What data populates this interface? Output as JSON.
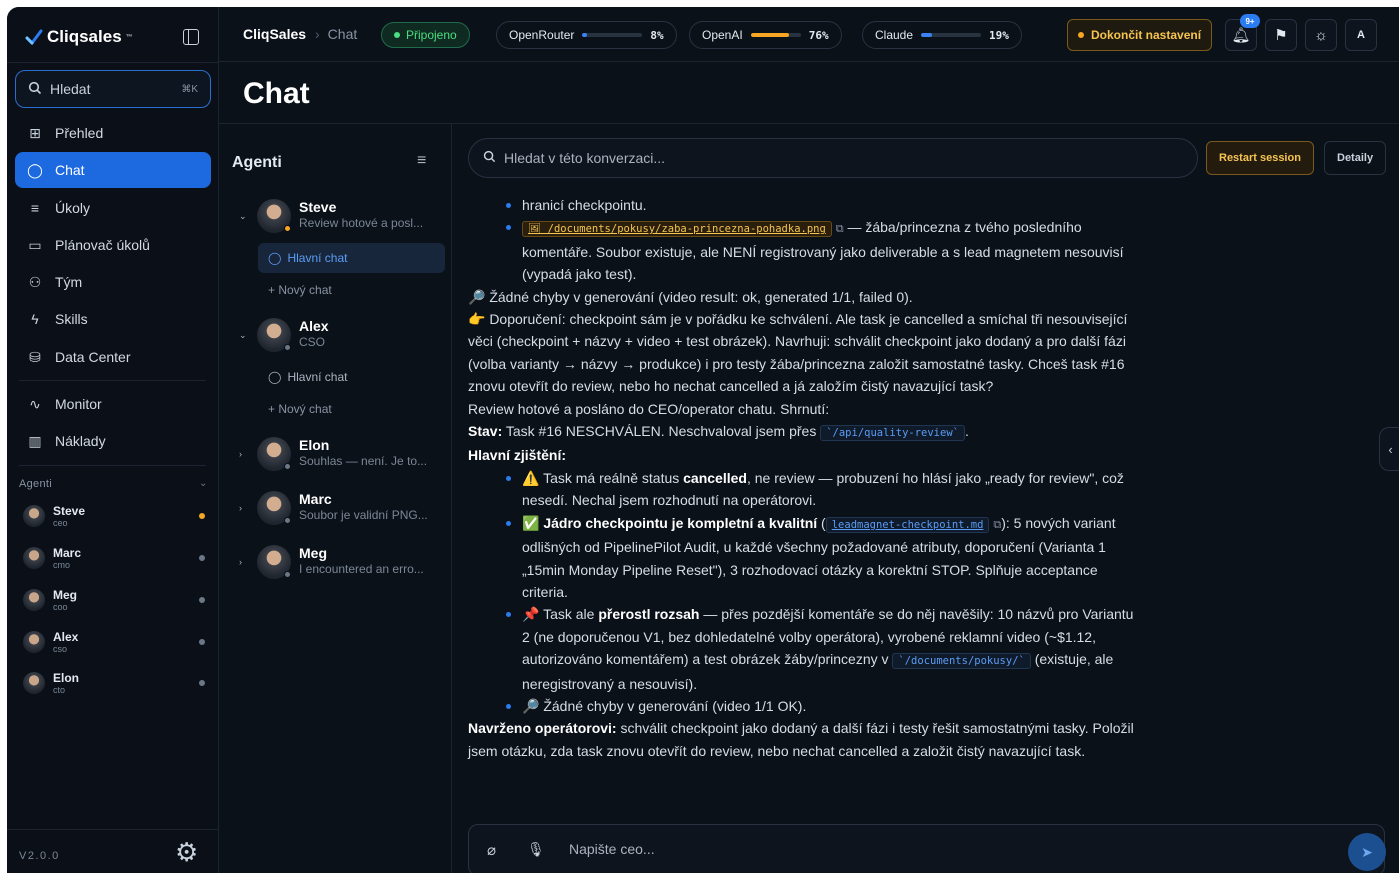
{
  "app": {
    "brand": "Cliqsales",
    "brand_tm": "™"
  },
  "sidebar": {
    "search_label": "Hledat",
    "search_shortcut": "⌘K",
    "nav": [
      {
        "label": "Přehled",
        "icon": "grid-icon"
      },
      {
        "label": "Chat",
        "icon": "chat-bubble-icon",
        "active": true
      },
      {
        "label": "Úkoly",
        "icon": "tasks-icon"
      },
      {
        "label": "Plánovač úkolů",
        "icon": "calendar-icon"
      },
      {
        "label": "Tým",
        "icon": "users-icon"
      },
      {
        "label": "Skills",
        "icon": "bolt-icon"
      },
      {
        "label": "Data Center",
        "icon": "database-icon"
      },
      {
        "label": "Monitor",
        "icon": "pulse-icon"
      },
      {
        "label": "Náklady",
        "icon": "bar-chart-icon"
      }
    ],
    "agents_title": "Agenti",
    "agents": [
      {
        "name": "Steve",
        "role": "ceo",
        "status": "active"
      },
      {
        "name": "Marc",
        "role": "cmo",
        "status": "idle"
      },
      {
        "name": "Meg",
        "role": "coo",
        "status": "idle"
      },
      {
        "name": "Alex",
        "role": "cso",
        "status": "idle"
      },
      {
        "name": "Elon",
        "role": "cto",
        "status": "idle"
      }
    ],
    "version": "V2.0.0"
  },
  "topbar": {
    "breadcrumb_root": "CliqSales",
    "breadcrumb_current": "Chat",
    "connection": "Připojeno",
    "meters": [
      {
        "label": "OpenRouter",
        "value": "8%",
        "fraction": 0.08,
        "color": "#3b82f6"
      },
      {
        "label": "OpenAI",
        "value": "76%",
        "fraction": 0.76,
        "color": "#f5a623"
      },
      {
        "label": "Claude",
        "value": "19%",
        "fraction": 0.19,
        "color": "#3b82f6"
      }
    ],
    "finish_setup": "Dokončit nastavení",
    "notifications_badge": "9+",
    "avatar_letter": "A"
  },
  "page": {
    "title": "Chat"
  },
  "agent_list": {
    "title": "Agenti",
    "agents": [
      {
        "name": "Steve",
        "summary": "Review hotové a posl..."
      },
      {
        "name": "Alex",
        "summary": "CSO"
      },
      {
        "name": "Elon",
        "summary": "Souhlas — není. Je to..."
      },
      {
        "name": "Marc",
        "summary": "Soubor je validní PNG..."
      },
      {
        "name": "Meg",
        "summary": "I encountered an erro..."
      }
    ],
    "main_chat": "Hlavní chat",
    "new_chat": "+ Nový chat"
  },
  "chat": {
    "search_placeholder": "Hledat v této konverzaci...",
    "restart": "Restart session",
    "details": "Detaily",
    "composer_placeholder": "Napište ceo...",
    "m1": "hranicí checkpointu.",
    "m2_code": "🖼 /documents/pokusy/zaba-princezna-pohadka.png",
    "m2_text": " — žába/princezna z tvého posledního komentáře. Soubor existuje, ale NENÍ registrovaný jako deliverable a s lead magnetem nesouvisí (vypadá jako test).",
    "m3": "🔎 Žádné chyby v generování (video result: ok, generated 1/1, failed 0).",
    "m4": "👉 Doporučení: checkpoint sám je v pořádku ke schválení. Ale task je cancelled a smíchal tři nesouvisející věci (checkpoint + názvy + video + test obrázek). Navrhuji: schválit checkpoint jako dodaný a pro další fázi (volba varianty → názvy → produkce) i pro testy žába/princezna založit samostatné tasky. Chceš task #16 znovu otevřít do review, nebo ho nechat cancelled a já založím čistý navazující task?",
    "m5": "Review hotové a posláno do CEO/operator chatu. Shrnutí:",
    "m6_label": "Stav:",
    "m6_text": " Task #16 NESCHVÁLEN. Neschvaloval jsem přes ",
    "m6_code": "`/api/quality-review`",
    "m6_end": ".",
    "m7": "Hlavní zjištění:",
    "b1_pre": "⚠️ Task má reálně status ",
    "b1_bold": "cancelled",
    "b1_post": ", ne review — probuzení ho hlásí jako „ready for review\", což nesedí. Nechal jsem rozhodnutí na operátorovi.",
    "b2_bold": "✅ Jádro checkpointu je kompletní a kvalitní",
    "b2_open": " (",
    "b2_code": "leadmagnet-checkpoint.md",
    "b2_post": "): 5 nových variant odlišných od PipelinePilot Audit, u každé všechny požadované atributy, doporučení (Varianta 1 „15min Monday Pipeline Reset\"), 3 rozhodovací otázky a korektní STOP. Splňuje acceptance criteria.",
    "b3_pre": "📌 Task ale ",
    "b3_bold": "přerostl rozsah",
    "b3_post": " — přes pozdější komentáře se do něj navěšily: 10 názvů pro Variantu 2 (ne doporučenou V1, bez dohledatelné volby operátora), vyrobené reklamní video (~$1.12, autorizováno komentářem) a test obrázek žáby/princezny v ",
    "b3_code": "`/documents/pokusy/`",
    "b3_end": " (existuje, ale neregistrovaný a nesouvisí).",
    "b4": "🔎 Žádné chyby v generování (video 1/1 OK).",
    "m8_label": "Navrženo operátorovi:",
    "m8_text": " schválit checkpoint jako dodaný a další fázi i testy řešit samostatnými tasky. Položil jsem otázku, zda task znovu otevřít do review, nebo nechat cancelled a založit čistý navazující task."
  }
}
